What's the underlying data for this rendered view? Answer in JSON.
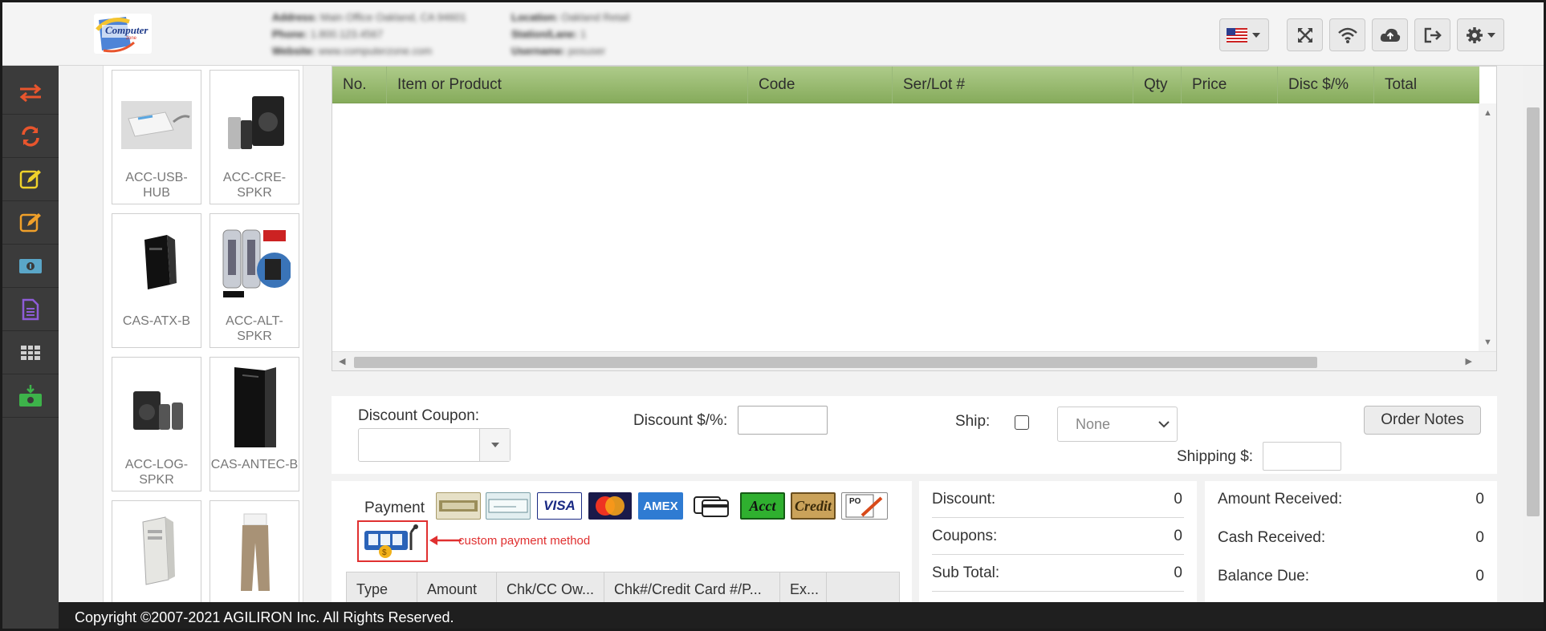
{
  "header": {
    "logo": {
      "line1": "Computer",
      "line2": "zone"
    },
    "info_left": [
      {
        "key": "Address:",
        "val": "Main Office Oakland, CA 94601"
      },
      {
        "key": "Phone:",
        "val": "1.800.123.4567"
      },
      {
        "key": "Website:",
        "val": "www.computerzone.com"
      }
    ],
    "info_right": [
      {
        "key": "Location:",
        "val": "Oakland Retail"
      },
      {
        "key": "Station/Lane:",
        "val": "1"
      },
      {
        "key": "Username:",
        "val": "posuser"
      }
    ],
    "buttons": [
      "language-flag",
      "fullscreen",
      "wifi",
      "cloud-upload",
      "logout",
      "settings"
    ]
  },
  "sidebar": {
    "items": [
      {
        "icon": "swap-icon",
        "color": "#e8552d"
      },
      {
        "icon": "refresh-icon",
        "color": "#e8552d"
      },
      {
        "icon": "edit-icon",
        "color": "#f0d22a"
      },
      {
        "icon": "edit-icon",
        "color": "#f0a02a"
      },
      {
        "icon": "cash-icon",
        "color": "#5aa6c8"
      },
      {
        "icon": "document-icon",
        "color": "#8e5cd8"
      },
      {
        "icon": "table-icon",
        "color": "#cfcfcf"
      },
      {
        "icon": "download-cash-icon",
        "color": "#3db34a"
      }
    ]
  },
  "products": [
    {
      "label": "ACC-USB-HUB"
    },
    {
      "label": "ACC-CRE-SPKR"
    },
    {
      "label": "CAS-ATX-B"
    },
    {
      "label": "ACC-ALT-SPKR"
    },
    {
      "label": "ACC-LOG-SPKR"
    },
    {
      "label": "CAS-ANTEC-B"
    },
    {
      "label": ""
    },
    {
      "label": ""
    }
  ],
  "cart": {
    "columns": [
      "No.",
      "Item or Product",
      "Code",
      "Ser/Lot #",
      "Qty",
      "Price",
      "Disc $/%",
      "Total"
    ]
  },
  "options": {
    "discount_coupon_label": "Discount Coupon:",
    "discount_label": "Discount $/%:",
    "ship_label": "Ship:",
    "ship_select": "None",
    "shipping_label": "Shipping $:",
    "order_notes": "Order Notes"
  },
  "payment": {
    "label": "Payment",
    "methods": [
      "Cash",
      "Check",
      "VISA",
      "MasterCard",
      "AMEX",
      "Card",
      "Acct",
      "Credit",
      "PO"
    ],
    "annotation": "custom payment method",
    "columns": [
      "Type",
      "Amount",
      "Chk/CC Ow...",
      "Chk#/Credit Card #/P...",
      "Ex..."
    ]
  },
  "totals": [
    {
      "label": "Discount:",
      "value": "0"
    },
    {
      "label": "Coupons:",
      "value": "0"
    },
    {
      "label": "Sub Total:",
      "value": "0"
    }
  ],
  "received": [
    {
      "label": "Amount Received:",
      "value": "0"
    },
    {
      "label": "Cash Received:",
      "value": "0"
    },
    {
      "label": "Balance Due:",
      "value": "0"
    }
  ],
  "footer": {
    "copyright": "Copyright ©2007-2021 AGILIRON Inc. All Rights Reserved."
  },
  "colors": {
    "grid_header": "#9fbf78",
    "annotation_red": "#e03030",
    "nav_bg": "#3b3b3b"
  }
}
